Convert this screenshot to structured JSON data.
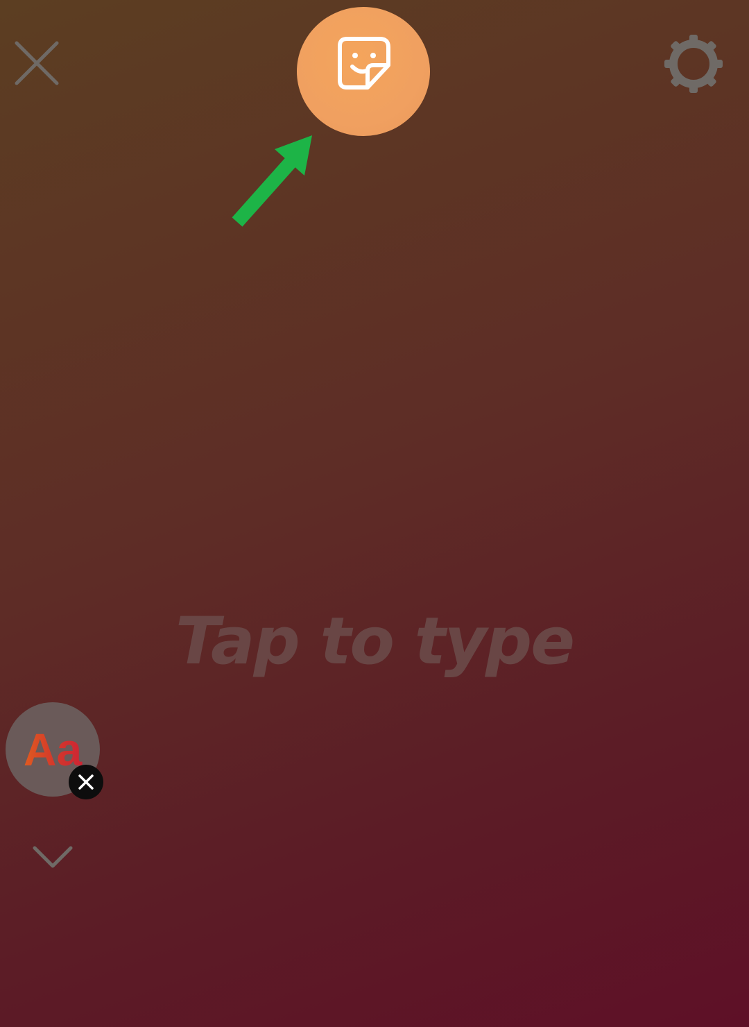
{
  "editor": {
    "placeholder": "Tap to type",
    "font_label": "Aa"
  },
  "toolbar": {
    "close_icon": "close-icon",
    "sticker_icon": "sticker-icon",
    "settings_icon": "gear-icon"
  },
  "colors": {
    "sticker_button": "#f0a060",
    "arrow": "#1db447",
    "icons": "#6f6a66"
  }
}
